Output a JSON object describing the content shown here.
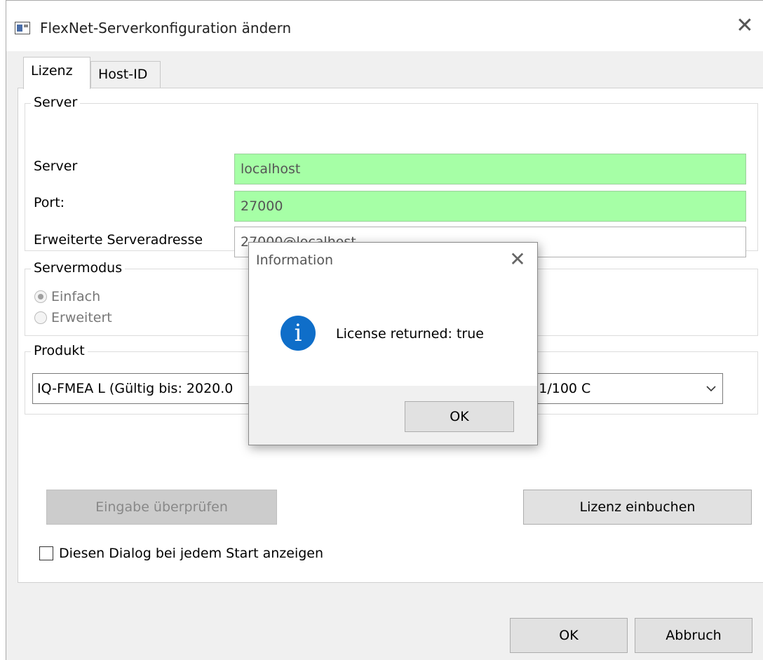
{
  "window": {
    "title": "FlexNet-Serverkonfiguration ändern",
    "close_glyph": "✕"
  },
  "tabs": [
    {
      "label": "Lizenz",
      "active": true
    },
    {
      "label": "Host-ID",
      "active": false
    }
  ],
  "server_group": {
    "legend": "Server",
    "server_label": "Server",
    "server_value": "localhost",
    "port_label": "Port:",
    "port_value": "27000",
    "extended_label": "Erweiterte Serveradresse",
    "extended_value": "27000@localhost"
  },
  "mode_group": {
    "legend": "Servermodus",
    "options": [
      {
        "label": "Einfach",
        "checked": true
      },
      {
        "label": "Erweitert",
        "checked": false
      }
    ]
  },
  "product_group": {
    "legend": "Produkt",
    "selected_value": "IQ-FMEA L (Gültig bis: 2020.0                                                   erwendung) (1/100 C"
  },
  "buttons": {
    "verify": "Eingabe überprüfen",
    "checkin": "Lizenz einbuchen",
    "ok": "OK",
    "cancel": "Abbruch"
  },
  "show_dialog_checkbox": {
    "label": "Diesen Dialog bei jedem Start anzeigen",
    "checked": false
  },
  "info_dialog": {
    "title": "Information",
    "close_glyph": "✕",
    "icon_glyph": "i",
    "message": "License returned: true",
    "ok_label": "OK"
  },
  "colors": {
    "valid_field": "#a6ffa6",
    "info_icon": "#0f6ec9"
  }
}
